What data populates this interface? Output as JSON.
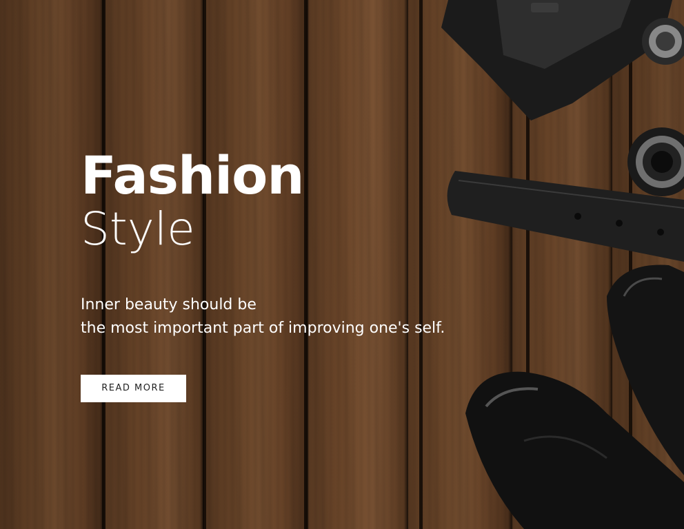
{
  "hero": {
    "title_main": "Fashion",
    "title_sub": "Style",
    "tagline_line1": "Inner beauty should be",
    "tagline_line2": "the most important part of improving one's self.",
    "button_label": "READ MORE"
  },
  "colors": {
    "text": "#ffffff",
    "button_bg": "#ffffff",
    "button_text": "#222222",
    "wood": "#6b4629"
  },
  "icons": [
    "camera-image",
    "belt-image",
    "shoe-image"
  ]
}
